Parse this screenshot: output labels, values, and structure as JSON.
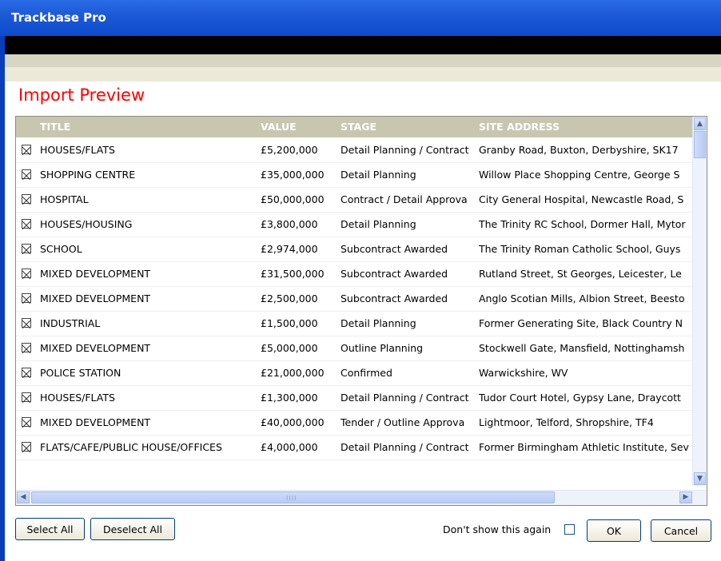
{
  "window": {
    "title": "Trackbase Pro"
  },
  "heading": "Import Preview",
  "grid": {
    "columns": [
      "TITLE",
      "VALUE",
      "STAGE",
      "SITE ADDRESS"
    ],
    "rows": [
      {
        "checked": true,
        "title": "HOUSES/FLATS",
        "value": "£5,200,000",
        "stage": "Detail Planning / Contract",
        "site": "Granby Road, Buxton, Derbyshire, SK17"
      },
      {
        "checked": true,
        "title": "SHOPPING CENTRE",
        "value": "£35,000,000",
        "stage": "Detail Planning",
        "site": "Willow Place Shopping Centre, George S"
      },
      {
        "checked": true,
        "title": "HOSPITAL",
        "value": "£50,000,000",
        "stage": "Contract / Detail Approva",
        "site": "City General Hospital, Newcastle Road, S"
      },
      {
        "checked": true,
        "title": "HOUSES/HOUSING",
        "value": "£3,800,000",
        "stage": "Detail Planning",
        "site": "The Trinity RC School, Dormer Hall, Mytor"
      },
      {
        "checked": true,
        "title": "SCHOOL",
        "value": "£2,974,000",
        "stage": "Subcontract Awarded",
        "site": "The Trinity Roman Catholic School, Guys"
      },
      {
        "checked": true,
        "title": "MIXED DEVELOPMENT",
        "value": "£31,500,000",
        "stage": "Subcontract Awarded",
        "site": "Rutland Street, St Georges, Leicester, Le"
      },
      {
        "checked": true,
        "title": "MIXED DEVELOPMENT",
        "value": "£2,500,000",
        "stage": "Subcontract Awarded",
        "site": "Anglo Scotian Mills, Albion Street, Beesto"
      },
      {
        "checked": true,
        "title": "INDUSTRIAL",
        "value": "£1,500,000",
        "stage": "Detail Planning",
        "site": "Former Generating Site, Black Country N"
      },
      {
        "checked": true,
        "title": "MIXED DEVELOPMENT",
        "value": "£5,000,000",
        "stage": "Outline Planning",
        "site": "Stockwell Gate, Mansfield, Nottinghamsh"
      },
      {
        "checked": true,
        "title": "POLICE STATION",
        "value": "£21,000,000",
        "stage": "Confirmed",
        "site": "Warwickshire, WV"
      },
      {
        "checked": true,
        "title": "HOUSES/FLATS",
        "value": "£1,300,000",
        "stage": "Detail Planning / Contract",
        "site": "Tudor Court Hotel, Gypsy Lane, Draycott"
      },
      {
        "checked": true,
        "title": "MIXED DEVELOPMENT",
        "value": "£40,000,000",
        "stage": "Tender / Outline Approva",
        "site": "Lightmoor, Telford, Shropshire, TF4"
      },
      {
        "checked": true,
        "title": "FLATS/CAFE/PUBLIC HOUSE/OFFICES",
        "value": "£4,000,000",
        "stage": "Detail Planning / Contract",
        "site": "Former Birmingham Athletic Institute, Sev"
      }
    ]
  },
  "footer": {
    "select_all": "Select All",
    "deselect_all": "Deselect All",
    "dont_show": "Don't show this again",
    "dont_show_checked": false,
    "ok": "OK",
    "cancel": "Cancel"
  }
}
